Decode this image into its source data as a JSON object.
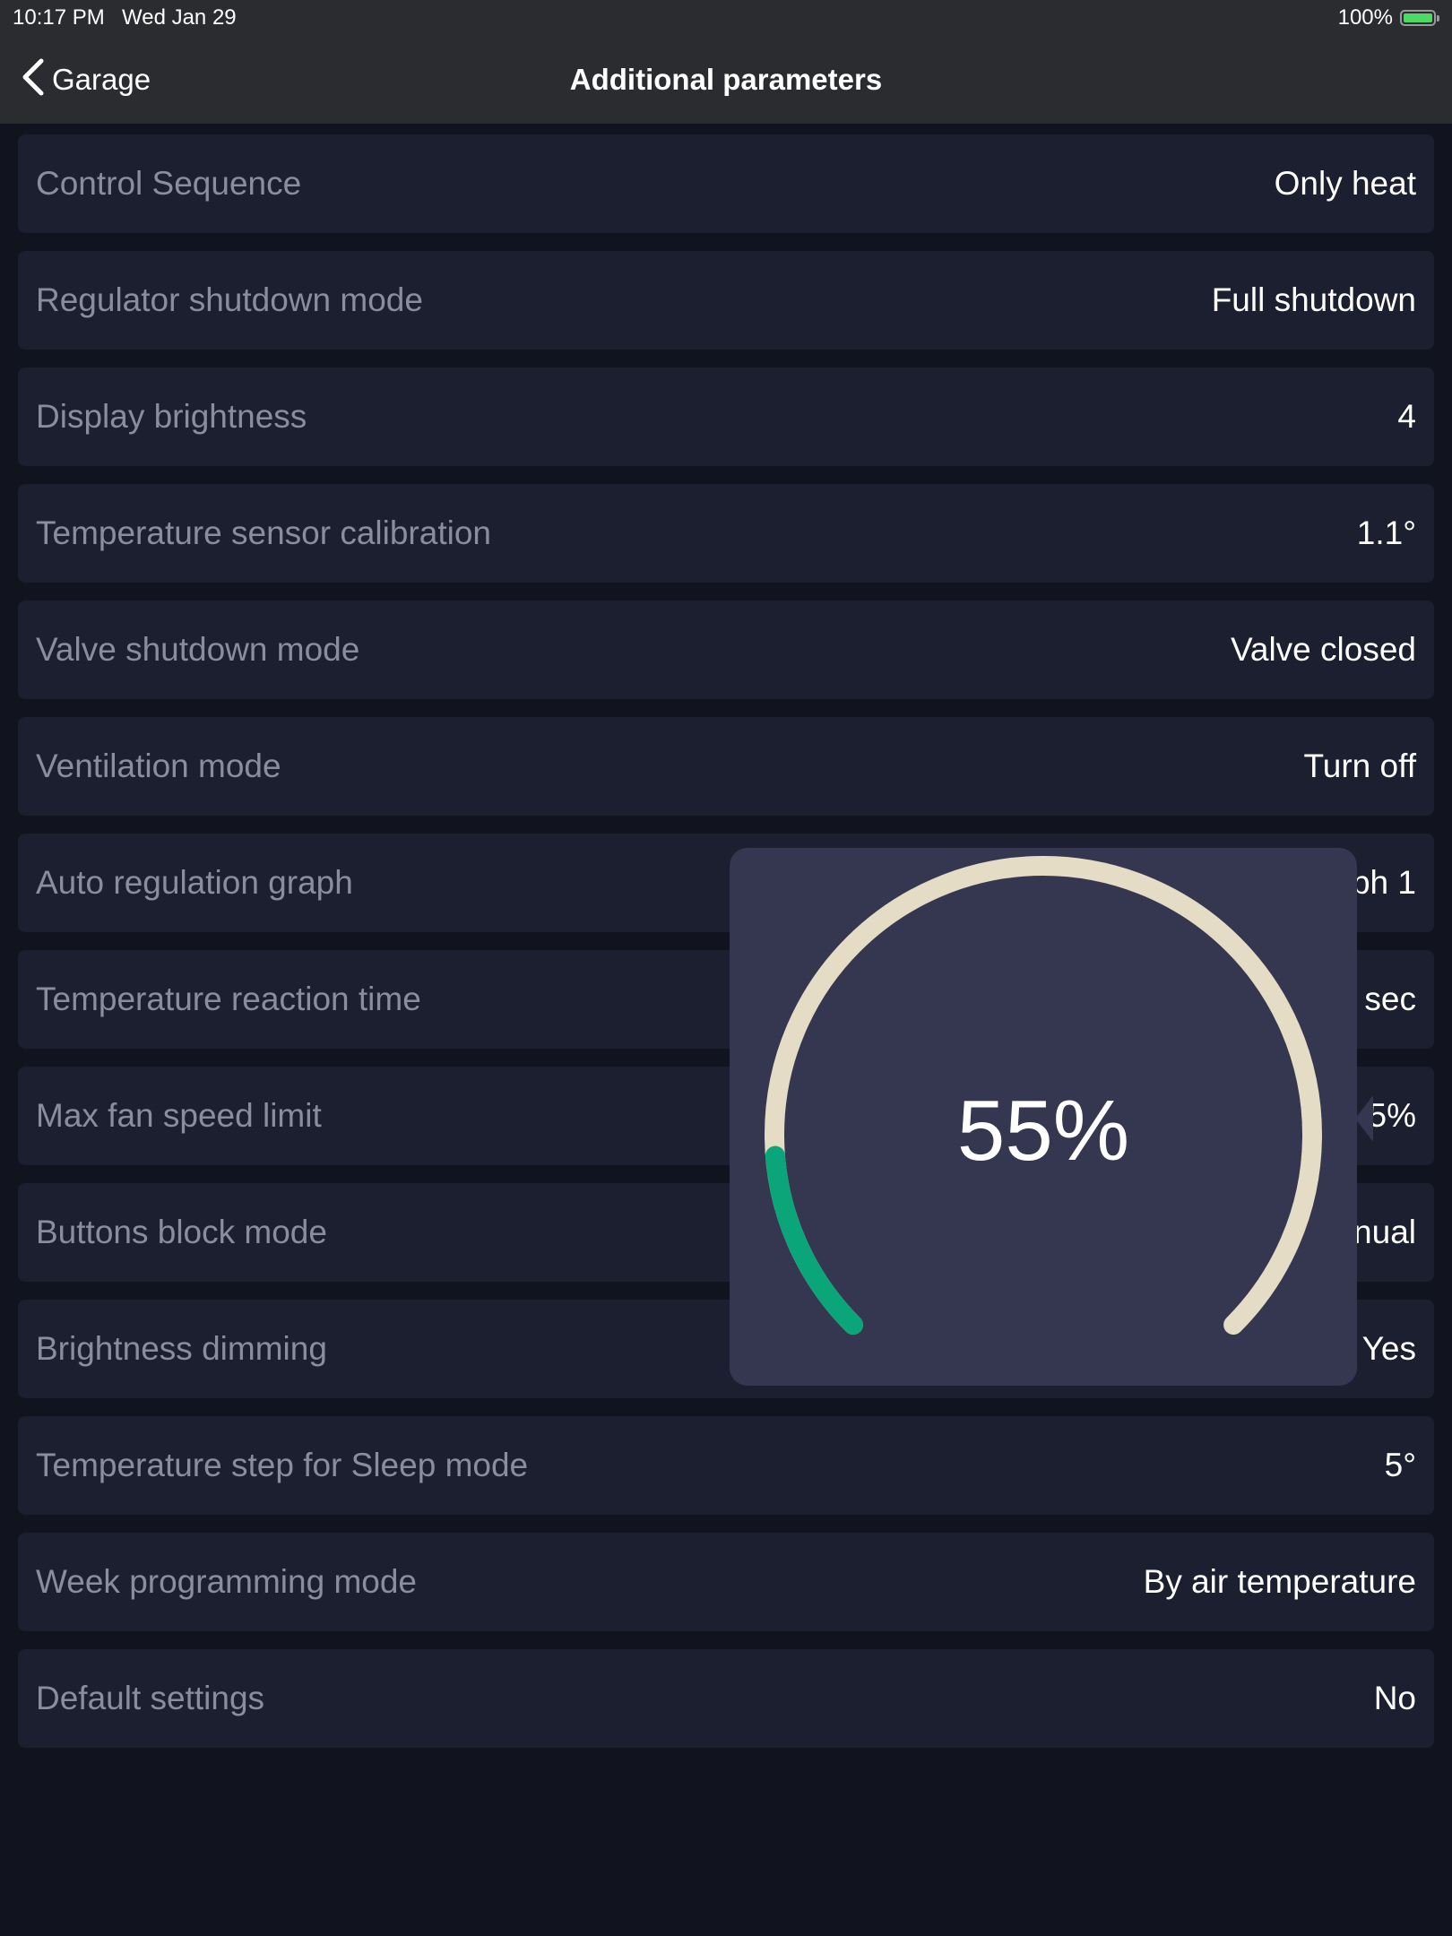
{
  "status_bar": {
    "time": "10:17 PM",
    "date": "Wed Jan 29",
    "battery": "100%"
  },
  "nav": {
    "back_label": "Garage",
    "title": "Additional parameters"
  },
  "rows": [
    {
      "label": "Control Sequence",
      "value": "Only heat"
    },
    {
      "label": "Regulator shutdown mode",
      "value": "Full shutdown"
    },
    {
      "label": "Display brightness",
      "value": "4"
    },
    {
      "label": "Temperature sensor calibration",
      "value": "1.1°"
    },
    {
      "label": "Valve shutdown mode",
      "value": "Valve closed"
    },
    {
      "label": "Ventilation mode",
      "value": "Turn off"
    },
    {
      "label": "Auto regulation graph",
      "value": "ph 1"
    },
    {
      "label": "Temperature reaction time",
      "value": "sec"
    },
    {
      "label": "Max fan speed limit",
      "value": "5%"
    },
    {
      "label": "Buttons block mode",
      "value": "nual"
    },
    {
      "label": "Brightness dimming",
      "value": "Yes"
    },
    {
      "label": "Temperature step for Sleep mode",
      "value": "5°"
    },
    {
      "label": "Week programming mode",
      "value": "By air temperature"
    },
    {
      "label": "Default settings",
      "value": "No"
    }
  ],
  "popup": {
    "value_text": "55%",
    "fill_fraction": 0.15,
    "colors": {
      "track": "#e4dcc4",
      "progress": "#0aa67a",
      "background": "#34374f"
    }
  }
}
